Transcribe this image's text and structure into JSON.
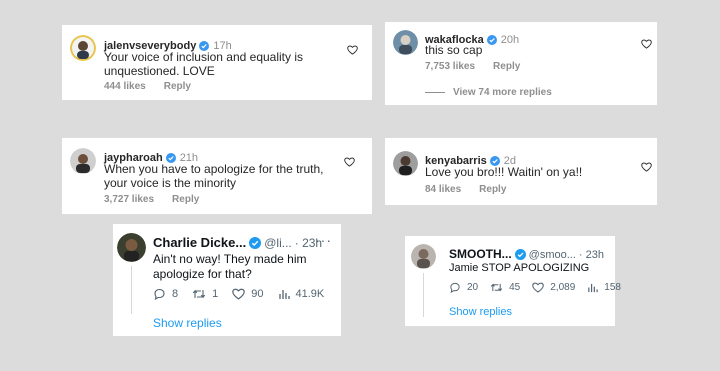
{
  "instagram_comments": [
    {
      "username": "jalenvseverybody",
      "time": "17h",
      "text": "Your voice of inclusion and equality is\nunquestioned. LOVE",
      "likes": "444 likes",
      "reply": "Reply"
    },
    {
      "username": "wakaflocka",
      "time": "20h",
      "text": "this so cap",
      "likes": "7,753 likes",
      "reply": "Reply",
      "view_more": "View 74 more replies"
    },
    {
      "username": "jaypharoah",
      "time": "21h",
      "text": "When you have to apologize for the truth,\nyour voice is the minority",
      "likes": "3,727 likes",
      "reply": "Reply"
    },
    {
      "username": "kenyabarris",
      "time": "2d",
      "text": "Love you bro!!! Waitin' on ya!!",
      "likes": "84 likes",
      "reply": "Reply"
    }
  ],
  "twitter_replies": [
    {
      "name": "Charlie Dicke...",
      "handle": "@li...",
      "time": "· 23h",
      "text": "Ain't no way! They made him\napologize for that?",
      "replies": "8",
      "retweets": "1",
      "likes": "90",
      "views": "41.9K",
      "show_replies": "Show replies"
    },
    {
      "name": "SMOOTH...",
      "handle": "@smoo...",
      "time": "· 23h",
      "text": "Jamie STOP APOLOGIZING",
      "replies": "20",
      "retweets": "45",
      "likes": "2,089",
      "views": "158",
      "show_replies": "Show replies"
    }
  ],
  "colors": {
    "verified": "#3897f0",
    "twitter_verified": "#1d9bf0",
    "link": "#1d9bf0",
    "muted": "#8e8e8e"
  }
}
